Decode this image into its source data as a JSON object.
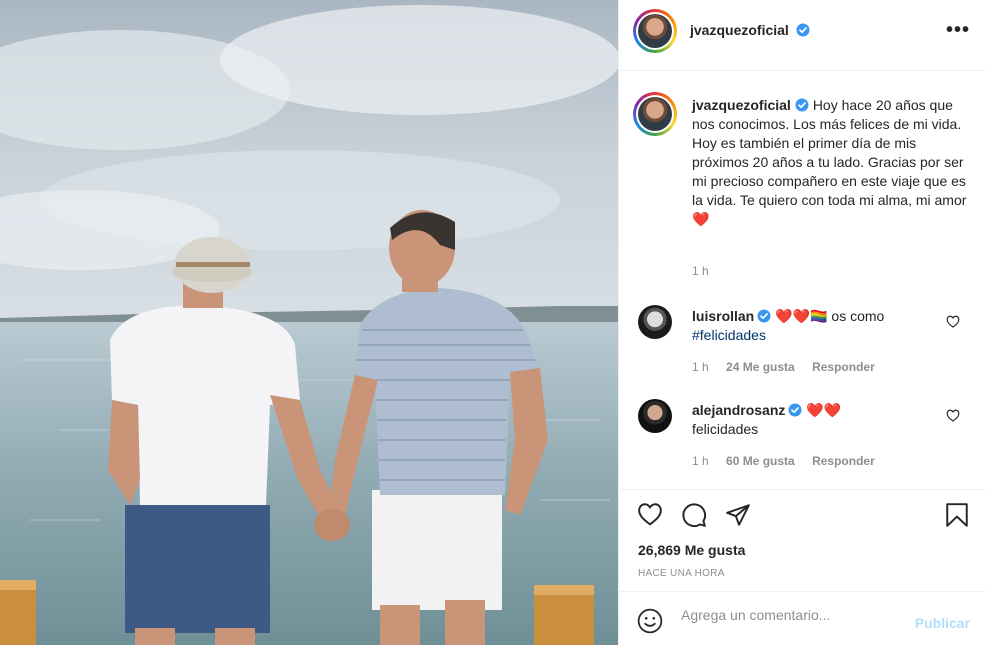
{
  "post": {
    "username": "jvazquezoficial",
    "more_label": "•••",
    "caption": "Hoy hace 20 años que nos conocimos. Los más felices de mi vida. Hoy es también el primer día de mis próximos 20 años a tu lado. Gracias por ser mi precioso compañero en este viaje que es la vida. Te quiero con toda mi alma, mi amor",
    "caption_emoji": "❤️",
    "caption_time": "1 h"
  },
  "comments": [
    {
      "username": "luisrollan",
      "emojis": "❤️❤️🏳️‍🌈",
      "text": " os como",
      "hashtag": "#felicidades",
      "time": "1 h",
      "likes": "24 Me gusta",
      "reply": "Responder"
    },
    {
      "username": "alejandrosanz",
      "emojis": "❤️❤️",
      "text": "felicidades",
      "time": "1 h",
      "likes": "60 Me gusta",
      "reply": "Responder"
    }
  ],
  "actions": {
    "likes_count": "26,869 Me gusta",
    "posted_ago": "HACE UNA HORA"
  },
  "comment_box": {
    "placeholder": "Agrega un comentario...",
    "publish_label": "Publicar"
  },
  "colors": {
    "verified": "#3897f0",
    "heart_red": "#ed4956",
    "publish_disabled": "#b2dffc"
  },
  "icons": [
    "heart-icon",
    "comment-icon",
    "share-icon",
    "bookmark-icon",
    "emoji-icon",
    "verified-badge-icon",
    "more-options-icon"
  ]
}
